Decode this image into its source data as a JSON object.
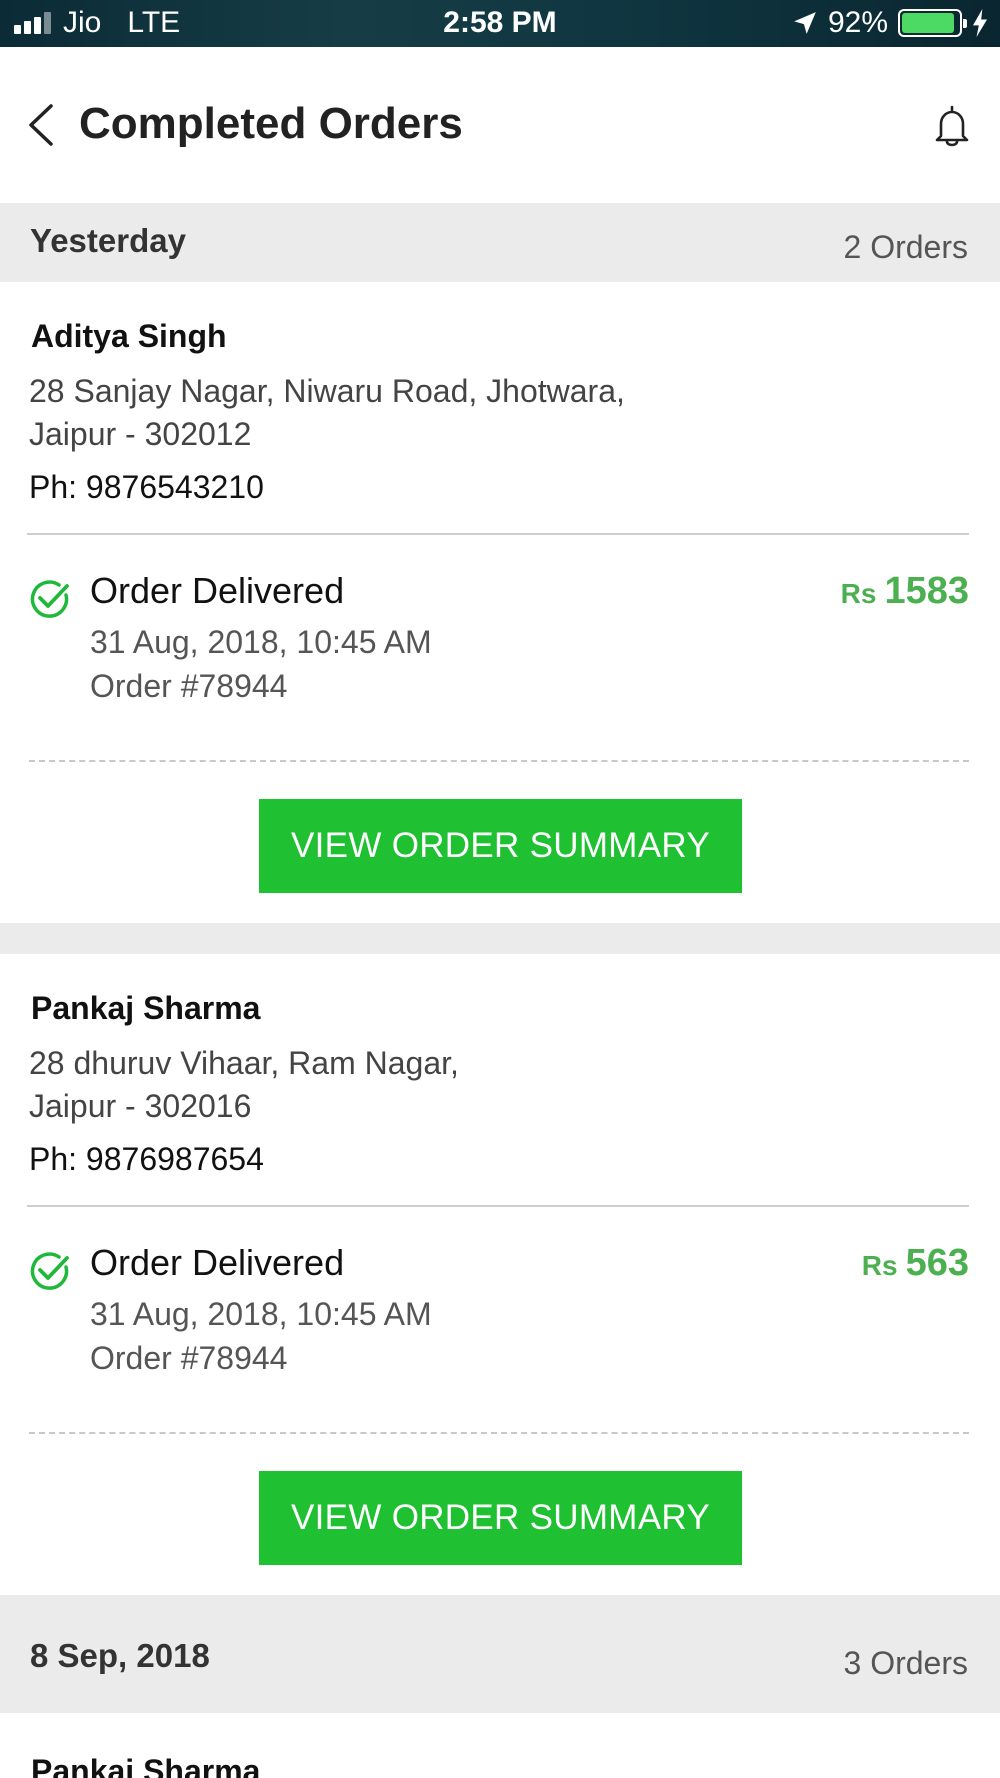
{
  "status_bar": {
    "carrier": "Jio",
    "network": "LTE",
    "time": "2:58 PM",
    "battery": "92%",
    "battery_level": 0.92,
    "icons": [
      "signal-icon",
      "location-arrow-icon",
      "battery-icon",
      "charging-bolt-icon"
    ]
  },
  "header": {
    "title": "Completed Orders",
    "back_icon": "chevron-left-icon",
    "bell_icon": "bell-icon"
  },
  "colors": {
    "accent_green": "#1fc133",
    "price_green": "#4caf50",
    "section_bg": "#ebebeb"
  },
  "sections": [
    {
      "title": "Yesterday",
      "count": "2 Orders",
      "orders": [
        {
          "name": "Aditya Singh",
          "address_line1": "28 Sanjay Nagar, Niwaru Road, Jhotwara,",
          "address_line2": "Jaipur - 302012",
          "phone": "Ph: 9876543210",
          "status": "Order Delivered",
          "date": "31 Aug, 2018, 10:45 AM",
          "order_no": "Order #78944",
          "currency": "Rs",
          "amount": "1583",
          "button": "VIEW ORDER SUMMARY"
        },
        {
          "name": "Pankaj Sharma",
          "address_line1": "28 dhuruv Vihaar, Ram Nagar,",
          "address_line2": "Jaipur - 302016",
          "phone": "Ph: 9876987654",
          "status": "Order Delivered",
          "date": "31 Aug, 2018, 10:45 AM",
          "order_no": "Order #78944",
          "currency": "Rs",
          "amount": "563",
          "button": "VIEW ORDER SUMMARY"
        }
      ]
    },
    {
      "title": "8 Sep, 2018",
      "count": "3 Orders",
      "orders": [
        {
          "name": "Pankaj Sharma"
        }
      ]
    }
  ]
}
